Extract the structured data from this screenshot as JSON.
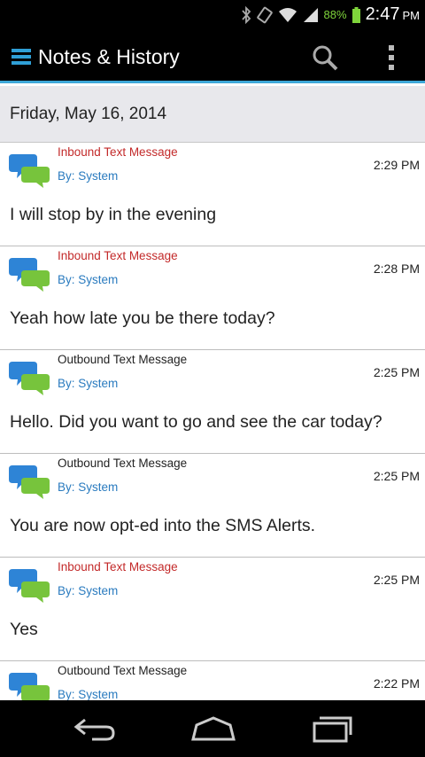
{
  "status_bar": {
    "battery_percent": "88%",
    "time": "2:47",
    "ampm": "PM",
    "icons": [
      "bluetooth-icon",
      "rotation-icon",
      "wifi-icon",
      "signal-icon",
      "battery-icon"
    ]
  },
  "action_bar": {
    "title": "Notes & History",
    "icons": [
      "menu-icon",
      "search-icon",
      "overflow-menu-icon"
    ]
  },
  "date_header": "Friday, May 16, 2014",
  "messages": [
    {
      "type": "Inbound Text Message",
      "direction": "inbound",
      "by": "By: System",
      "time": "2:29 PM",
      "body": "I will stop by in the evening"
    },
    {
      "type": "Inbound Text Message",
      "direction": "inbound",
      "by": "By: System",
      "time": "2:28 PM",
      "body": "Yeah how late you be there today?"
    },
    {
      "type": "Outbound Text Message",
      "direction": "outbound",
      "by": "By: System",
      "time": "2:25 PM",
      "body": "Hello. Did you want to go and see the car today?"
    },
    {
      "type": "Outbound Text Message",
      "direction": "outbound",
      "by": "By: System",
      "time": "2:25 PM",
      "body": "You are now opt-ed into the SMS Alerts."
    },
    {
      "type": "Inbound Text Message",
      "direction": "inbound",
      "by": "By: System",
      "time": "2:25 PM",
      "body": "Yes"
    },
    {
      "type": "Outbound Text Message",
      "direction": "outbound",
      "by": "By: System",
      "time": "2:22 PM",
      "body": ""
    }
  ],
  "nav_bar": {
    "icons": [
      "back-icon",
      "home-icon",
      "recent-apps-icon"
    ]
  },
  "colors": {
    "accent": "#3ea8d8",
    "inbound": "#c32a2a",
    "by_link": "#2a7bbf",
    "battery": "#7fd43b"
  }
}
